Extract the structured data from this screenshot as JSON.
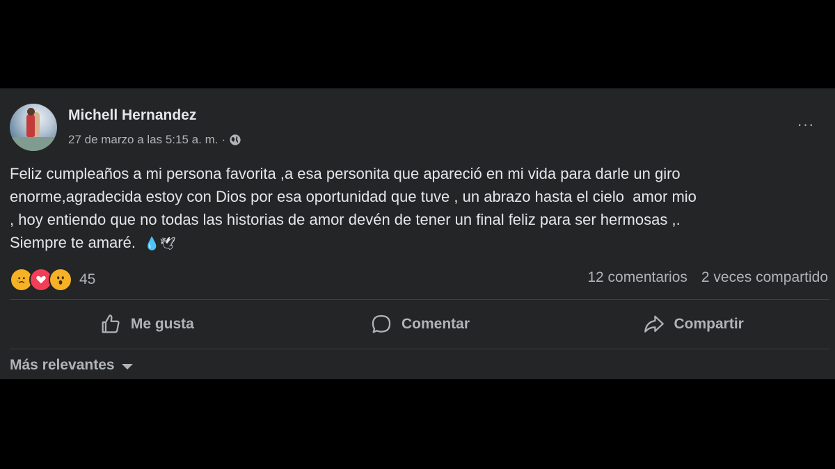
{
  "post": {
    "author": "Michell Hernandez",
    "timestamp": "27 de marzo a las 5:15 a. m.",
    "separator": "·",
    "body": "Feliz cumpleaños a mi persona favorita ,a esa personita que apareció en mi vida para darle un giro\nenorme,agradecida estoy con Dios por esa oportunidad que tuve , un abrazo hasta el cielo  amor mio\n, hoy entiendo que no todas las historias de amor devén de tener un final feliz para ser hermosas ,.\nSiempre te amaré.",
    "body_emojis": "💧🕊",
    "more_icon": "···"
  },
  "reactions": {
    "icons": [
      "sad-face-icon",
      "love-heart-icon",
      "wow-face-icon"
    ],
    "count": "45"
  },
  "stats": {
    "comments": "12 comentarios",
    "shares": "2 veces compartido"
  },
  "actions": {
    "like": "Me gusta",
    "comment": "Comentar",
    "share": "Compartir"
  },
  "sort": {
    "label": "Más relevantes"
  },
  "colors": {
    "background": "#242526",
    "text": "#e4e6eb",
    "secondary": "#b0b3b8",
    "divider": "#3e4042"
  }
}
